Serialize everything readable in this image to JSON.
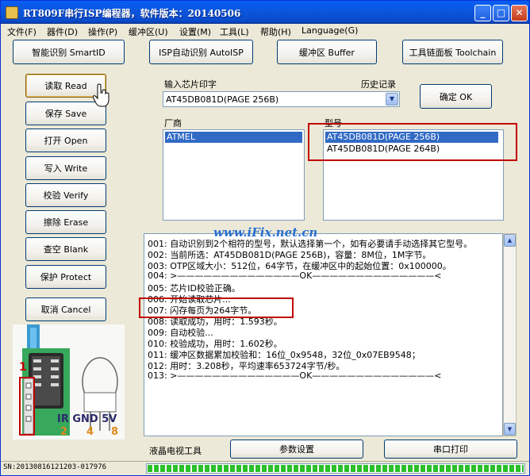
{
  "window": {
    "title": "RT809F串行ISP编程器，软件版本：20140506",
    "controls": {
      "minimize": "_",
      "maximize": "□",
      "close": "✕"
    }
  },
  "menu": [
    "文件(F)",
    "器件(D)",
    "操作(P)",
    "缓冲区(U)",
    "设置(M)",
    "工具(L)",
    "帮助(H)",
    "Language(G)"
  ],
  "toolbar": {
    "smart_id": "智能识别 SmartID",
    "isp_auto": "ISP自动识别 AutoISP",
    "buffer": "缓冲区 Buffer",
    "toolchain": "工具链面板 Toolchain"
  },
  "actions": {
    "read": "读取 Read",
    "save": "保存 Save",
    "open": "打开 Open",
    "write": "写入 Write",
    "verify": "校验 Verify",
    "erase": "擦除 Erase",
    "blank": "查空 Blank",
    "protect": "保护 Protect",
    "cancel": "取消 Cancel"
  },
  "chip_input": {
    "label": "输入芯片印字",
    "history_label": "历史记录",
    "value": "AT45DB081D(PAGE 256B)",
    "confirm": "确定 OK"
  },
  "vendor": {
    "label": "厂商",
    "items": [
      "ATMEL"
    ],
    "selected": 0
  },
  "model": {
    "label": "型号",
    "items": [
      "AT45DB081D(PAGE 256B)",
      "AT45DB081D(PAGE 264B)"
    ],
    "selected": 0
  },
  "watermark": "www.iFix.net.cn",
  "log": [
    "001: 自动识别到2个相符的型号，默认选择第一个，如有必要请手动选择其它型号。",
    "002: 当前所选：AT45DB081D(PAGE 256B)，容量：8M位，1M字节。",
    "003: OTP区域大小：512位，64字节，在缓冲区中的起始位置：0x100000。",
    "004: >——————————————OK——————————————<",
    "005: 芯片ID校验正确。",
    "006: 开始读取芯片...",
    "007: 闪存每页为264字节。",
    "008: 读取成功，用时：1.593秒。",
    "009: 自动校验...",
    "010: 校验成功，用时：1.602秒。",
    "011: 缓冲区数据累加校验和：16位_0x9548，32位_0x07EB9548；",
    "012: 用时：3.208秒，平均速率653724字节/秒。",
    "013: >——————————————OK——————————————<"
  ],
  "bottom": {
    "tv_tool": "液晶电视工具",
    "params": "参数设置",
    "serial_print": "串口打印"
  },
  "status": {
    "serial_number": "SN:20130816121203-017976",
    "progress": 1.0
  },
  "board": {
    "pin_labels": "IR GND 5V",
    "pin_numbers": [
      "2",
      "4",
      "8"
    ],
    "marker": "1"
  }
}
